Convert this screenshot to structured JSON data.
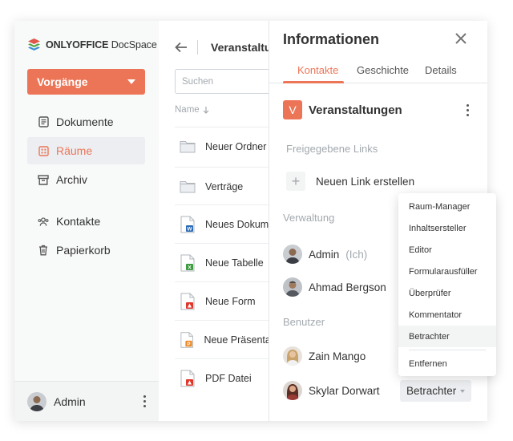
{
  "app": {
    "logo_brand": "ONLYOFFICE",
    "logo_product": "DocSpace",
    "primary_button": "Vorgänge",
    "accent_color": "#ed7557"
  },
  "sidebar": {
    "items": [
      {
        "label": "Dokumente",
        "icon": "document-icon"
      },
      {
        "label": "Räume",
        "icon": "rooms-icon",
        "active": true
      },
      {
        "label": "Archiv",
        "icon": "archive-icon"
      },
      {
        "label": "Kontakte",
        "icon": "contacts-icon"
      },
      {
        "label": "Papierkorb",
        "icon": "trash-icon"
      }
    ],
    "footer_user": "Admin"
  },
  "files": {
    "title": "Veranstaltungen",
    "search_placeholder": "Suchen",
    "column_name": "Name",
    "rows": [
      {
        "name": "Neuer Ordner",
        "type": "folder"
      },
      {
        "name": "Verträge",
        "type": "folder"
      },
      {
        "name": "Neues Dokument",
        "type": "docx"
      },
      {
        "name": "Neue Tabelle",
        "type": "xlsx"
      },
      {
        "name": "Neue Form",
        "type": "pdf-form"
      },
      {
        "name": "Neue Präsentation",
        "type": "pptx"
      },
      {
        "name": "PDF Datei",
        "type": "pdf"
      }
    ]
  },
  "panel": {
    "title": "Informationen",
    "tabs": [
      "Kontakte",
      "Geschichte",
      "Details"
    ],
    "room_initial": "V",
    "room_name": "Veranstaltungen",
    "shared_links_label": "Freigegebene Links",
    "new_link_label": "Neuen Link erstellen",
    "admin_section": "Verwaltung",
    "users_section": "Benutzer",
    "admins": [
      {
        "name": "Admin",
        "suffix": "(Ich)"
      },
      {
        "name": "Ahmad Bergson",
        "suffix": ""
      }
    ],
    "users": [
      {
        "name": "Zain Mango"
      },
      {
        "name": "Skylar Dorwart",
        "role": "Betrachter"
      }
    ]
  },
  "role_menu": {
    "items": [
      "Raum-Manager",
      "Inhaltsersteller",
      "Editor",
      "Formularausfüller",
      "Überprüfer",
      "Kommentator",
      "Betrachter"
    ],
    "highlighted": "Betrachter",
    "remove": "Entfernen"
  }
}
